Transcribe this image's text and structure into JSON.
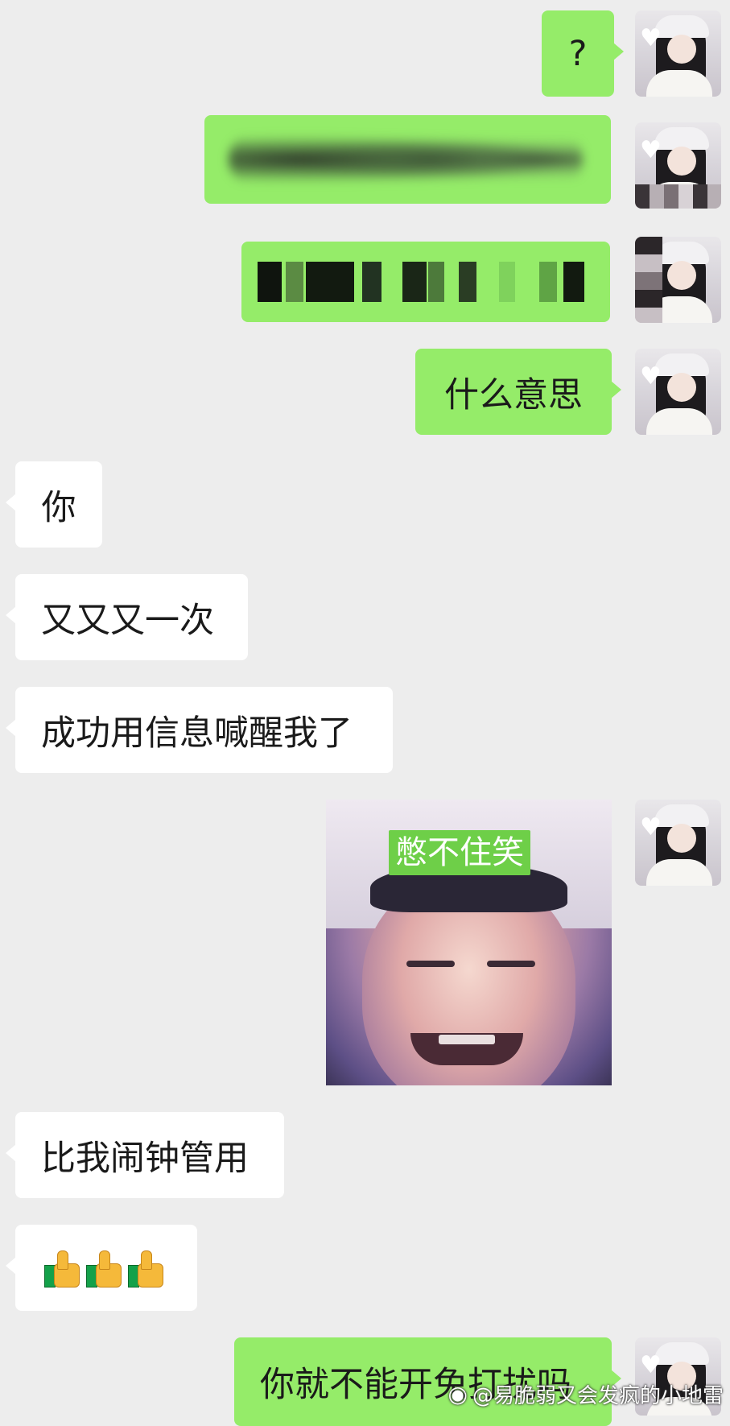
{
  "messages": {
    "m1": {
      "text": "?"
    },
    "m4": {
      "text": "什么意思"
    },
    "m5": {
      "text": "你"
    },
    "m6": {
      "text": "又又又一次"
    },
    "m7": {
      "text": "成功用信息喊醒我了"
    },
    "m8": {
      "caption": "憋不住笑"
    },
    "m9": {
      "text": "比我闹钟管用"
    },
    "m10": {
      "emoji": "👍👍👍"
    },
    "m11": {
      "text": "你就不能开免打扰吗"
    }
  },
  "watermark": {
    "text": "@易脆弱又会发疯的小地雷",
    "logo": "weibo-icon"
  },
  "colors": {
    "outgoing": "#95ec69",
    "incoming": "#ffffff",
    "background": "#ededed"
  }
}
